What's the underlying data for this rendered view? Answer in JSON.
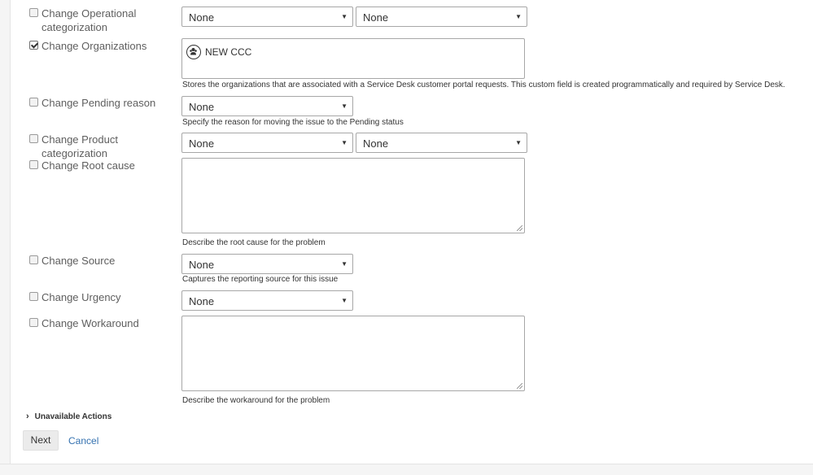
{
  "fields": {
    "operational": {
      "label": "Change Operational categorization",
      "checked": false,
      "select1": "None",
      "select2": "None"
    },
    "organizations": {
      "label": "Change Organizations",
      "checked": true,
      "value": "NEW CCC",
      "description": "Stores the organizations that are associated with a Service Desk customer portal requests. This custom field is created programmatically and required by Service Desk."
    },
    "pending": {
      "label": "Change Pending reason",
      "checked": false,
      "select": "None",
      "description": "Specify the reason for moving the issue to the Pending status"
    },
    "product": {
      "label": "Change Product categorization",
      "checked": false,
      "select1": "None",
      "select2": "None"
    },
    "root_cause": {
      "label": "Change Root cause",
      "checked": false,
      "description": "Describe the root cause for the problem"
    },
    "source": {
      "label": "Change Source",
      "checked": false,
      "select": "None",
      "description": "Captures the reporting source for this issue"
    },
    "urgency": {
      "label": "Change Urgency",
      "checked": false,
      "select": "None"
    },
    "workaround": {
      "label": "Change Workaround",
      "checked": false,
      "description": "Describe the workaround for the problem"
    }
  },
  "unavailable_actions": {
    "label": "Unavailable Actions",
    "icon": "chevron-right-icon"
  },
  "buttons": {
    "next": "Next",
    "cancel": "Cancel"
  },
  "colors": {
    "link": "#3572b0",
    "border": "#a7a7a7"
  }
}
